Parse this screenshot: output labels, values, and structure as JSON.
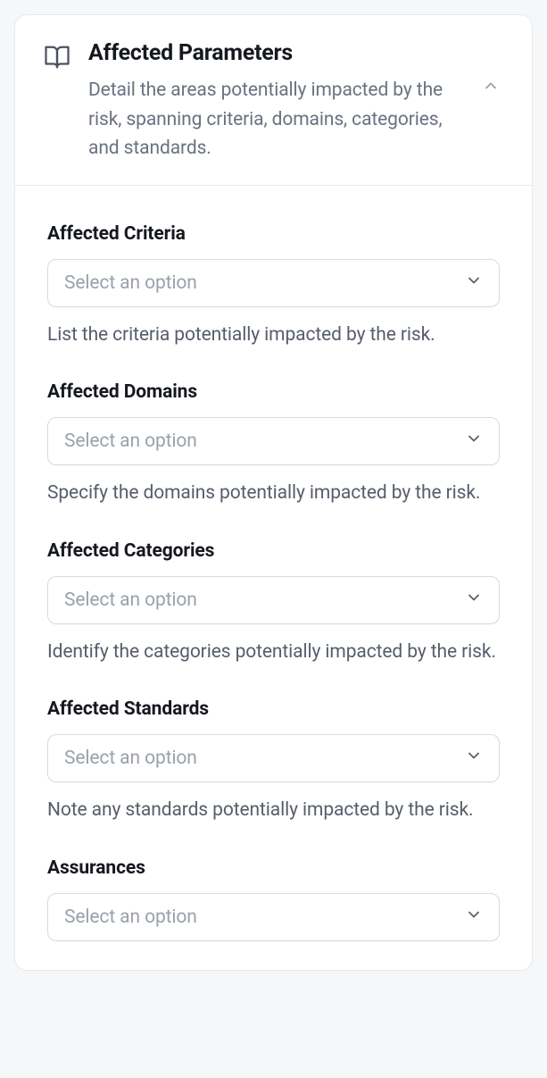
{
  "header": {
    "title": "Affected Parameters",
    "subtitle": "Detail the areas potentially impacted by the risk, spanning criteria, domains, categories, and standards."
  },
  "fields": {
    "criteria": {
      "label": "Affected Criteria",
      "placeholder": "Select an option",
      "help": "List the criteria potentially impacted by the risk."
    },
    "domains": {
      "label": "Affected Domains",
      "placeholder": "Select an option",
      "help": "Specify the domains potentially impacted by the risk."
    },
    "categories": {
      "label": "Affected Categories",
      "placeholder": "Select an option",
      "help": "Identify the categories potentially impacted by the risk."
    },
    "standards": {
      "label": "Affected Standards",
      "placeholder": "Select an option",
      "help": "Note any standards potentially impacted by the risk."
    },
    "assurances": {
      "label": "Assurances",
      "placeholder": "Select an option"
    }
  }
}
